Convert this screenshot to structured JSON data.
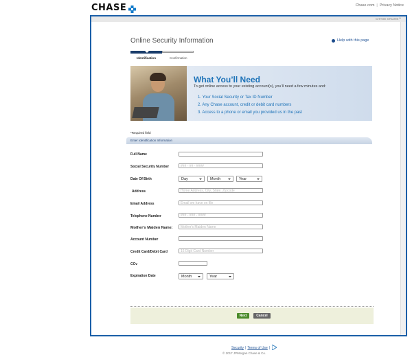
{
  "header": {
    "logo_text": "CHASE",
    "links": [
      "Chase.com",
      "Privacy Notice"
    ],
    "brand_color": "#117aca"
  },
  "frame": {
    "strip_text": "CHASE ONLINE℠"
  },
  "page": {
    "title": "Online Security Information",
    "help_link": "Help with this page",
    "steps": [
      "Identification",
      "Confirmation"
    ],
    "current_step": "Identification"
  },
  "banner": {
    "heading": "What You’ll Need",
    "subtitle": "To get online access to your existing account(s), you’ll need a few minutes and:",
    "items": [
      "1. Your Social Security or Tax ID Number",
      "2. Any Chase account, credit or debit card numbers",
      "3. Access to a phone or email you provided us in the past"
    ]
  },
  "form": {
    "required_note": "*Required field",
    "section_title": "Enter Identification Information",
    "fields": {
      "full_name": {
        "label": "Full Name",
        "placeholder": ""
      },
      "ssn": {
        "label": "Social Security Number",
        "placeholder": "### - ## - ####"
      },
      "dob": {
        "label": "Date Of Birth",
        "day": "Day",
        "month": "Month",
        "year": "Year"
      },
      "address": {
        "label": "Address",
        "placeholder": "Home Address, City, State, Zipcode"
      },
      "email": {
        "label": "Email Address",
        "placeholder": "Email we have on file"
      },
      "phone": {
        "label": "Telephone Number",
        "placeholder": "### - ### - ####"
      },
      "maiden": {
        "label": "Mother's Maiden Name:",
        "placeholder": "Mother's Maiden Name"
      },
      "account": {
        "label": "Account Number",
        "placeholder": ""
      },
      "card": {
        "label": "Credit Card/Debit Card",
        "placeholder": "16 Digit Card Number"
      },
      "cvv": {
        "label": "CCv",
        "placeholder": ""
      },
      "exp": {
        "label": "Expiration Date",
        "month": "Month",
        "year": "Year"
      }
    },
    "buttons": {
      "next": "Next",
      "cancel": "Cancel"
    }
  },
  "footer": {
    "links": [
      "Security",
      "Terms of Use"
    ],
    "separator": "|",
    "copyright": "© 2017 JPMorgan Chase & Co."
  }
}
